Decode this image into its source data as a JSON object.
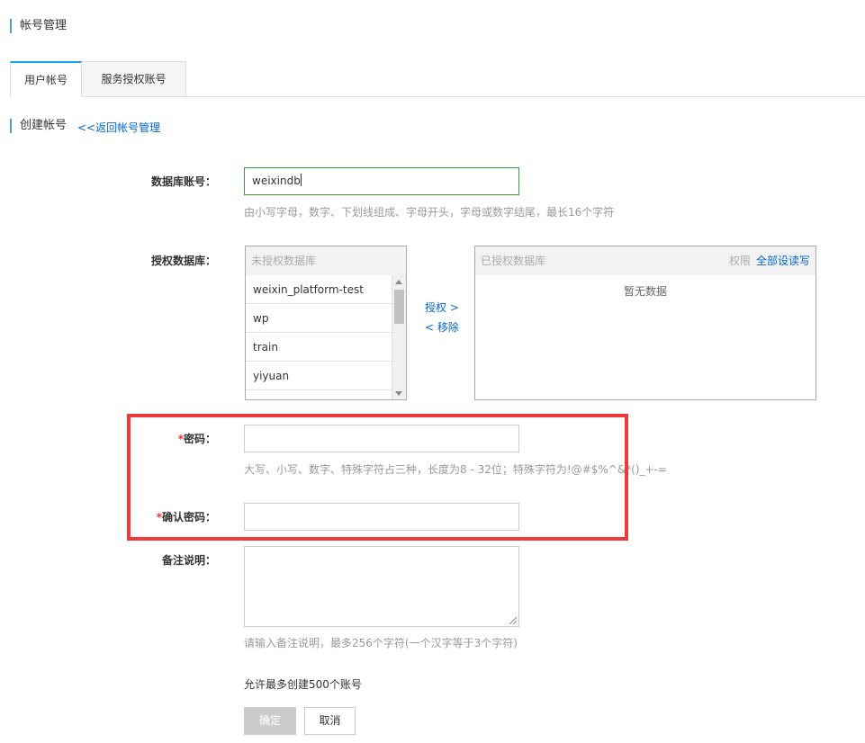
{
  "page_title": "帐号管理",
  "tabs": [
    {
      "label": "用户帐号",
      "active": true
    },
    {
      "label": "服务授权账号",
      "active": false
    }
  ],
  "section": {
    "title": "创建帐号",
    "back_link": "<<返回帐号管理"
  },
  "db_account": {
    "label": "数据库账号：",
    "value": "weixindb",
    "hint": "由小写字母，数字、下划线组成、字母开头，字母或数字结尾，最长16个字符"
  },
  "authorize": {
    "label": "授权数据库：",
    "left_header": "未授权数据库",
    "left_items": [
      "weixin_platform-test",
      "wp",
      "train",
      "yiyuan"
    ],
    "grant_link": "授权 >",
    "remove_link": "< 移除",
    "right_header": "已授权数据库",
    "right_perm_label": "权限",
    "right_set_all": "全部设读写",
    "right_empty": "暂无数据"
  },
  "password": {
    "required_mark": "*",
    "label": "密码：",
    "value": "",
    "hint": "大写、小写、数字、特殊字符占三种，长度为8 - 32位；特殊字符为!@#$%^&*()_+-="
  },
  "confirm_password": {
    "required_mark": "*",
    "label": "确认密码：",
    "value": ""
  },
  "remark": {
    "label": "备注说明：",
    "value": "",
    "hint": "请输入备注说明，最多256个字符(一个汉字等于3个字符)"
  },
  "limit_note": "允许最多创建500个账号",
  "buttons": {
    "ok": "确定",
    "cancel": "取消"
  },
  "colors": {
    "accent_blue": "#1e9fe5",
    "link": "#0066cc",
    "required": "#ee3333",
    "highlight_frame": "#f03a3a",
    "focus_border": "#3a9c3a"
  }
}
